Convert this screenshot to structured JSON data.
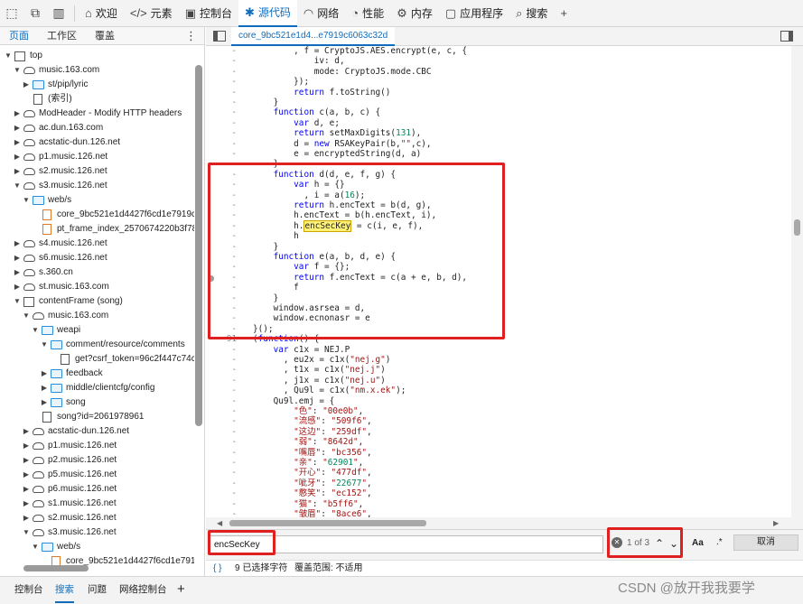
{
  "toolbar": {
    "tabs": [
      {
        "icon": "home-icon",
        "glyph": "⌂",
        "label": "欢迎"
      },
      {
        "icon": "elements-icon",
        "glyph": "</>",
        "label": "元素"
      },
      {
        "icon": "console-icon",
        "glyph": "▣",
        "label": "控制台"
      },
      {
        "icon": "sources-bug-icon",
        "glyph": "✱",
        "label": "源代码",
        "active": true
      },
      {
        "icon": "network-wifi-icon",
        "glyph": "◠",
        "label": "网络"
      },
      {
        "icon": "performance-icon",
        "glyph": "◔",
        "label": "性能"
      },
      {
        "icon": "memory-gear-icon",
        "glyph": "⚙",
        "label": "内存"
      },
      {
        "icon": "application-icon",
        "glyph": "▢",
        "label": "应用程序"
      },
      {
        "icon": "search-icon",
        "glyph": "⌕",
        "label": "搜索"
      }
    ],
    "add": "+"
  },
  "left": {
    "tabs": [
      "页面",
      "工作区",
      "覆盖"
    ],
    "more": "⋮",
    "tree": [
      {
        "indent": 0,
        "arrow": "▼",
        "icon": "frame",
        "label": "top"
      },
      {
        "indent": 1,
        "arrow": "▼",
        "icon": "cloud",
        "label": "music.163.com"
      },
      {
        "indent": 2,
        "arrow": "▶",
        "icon": "folder",
        "label": "st/pip/lyric"
      },
      {
        "indent": 2,
        "arrow": "",
        "icon": "file",
        "label": "(索引)"
      },
      {
        "indent": 1,
        "arrow": "▶",
        "icon": "cloud",
        "label": "ModHeader - Modify HTTP headers"
      },
      {
        "indent": 1,
        "arrow": "▶",
        "icon": "cloud",
        "label": "ac.dun.163.com"
      },
      {
        "indent": 1,
        "arrow": "▶",
        "icon": "cloud",
        "label": "acstatic-dun.126.net"
      },
      {
        "indent": 1,
        "arrow": "▶",
        "icon": "cloud",
        "label": "p1.music.126.net"
      },
      {
        "indent": 1,
        "arrow": "▶",
        "icon": "cloud",
        "label": "s2.music.126.net"
      },
      {
        "indent": 1,
        "arrow": "▼",
        "icon": "cloud",
        "label": "s3.music.126.net"
      },
      {
        "indent": 2,
        "arrow": "▼",
        "icon": "folder",
        "label": "web/s"
      },
      {
        "indent": 3,
        "arrow": "",
        "icon": "file-orange",
        "label": "core_9bc521e1d4427f6cd1e7919c"
      },
      {
        "indent": 3,
        "arrow": "",
        "icon": "file-orange",
        "label": "pt_frame_index_2570674220b3f78"
      },
      {
        "indent": 1,
        "arrow": "▶",
        "icon": "cloud",
        "label": "s4.music.126.net"
      },
      {
        "indent": 1,
        "arrow": "▶",
        "icon": "cloud",
        "label": "s6.music.126.net"
      },
      {
        "indent": 1,
        "arrow": "▶",
        "icon": "cloud",
        "label": "s.360.cn"
      },
      {
        "indent": 1,
        "arrow": "▶",
        "icon": "cloud",
        "label": "st.music.163.com"
      },
      {
        "indent": 1,
        "arrow": "▼",
        "icon": "frame",
        "label": "contentFrame (song)"
      },
      {
        "indent": 2,
        "arrow": "▼",
        "icon": "cloud",
        "label": "music.163.com"
      },
      {
        "indent": 3,
        "arrow": "▼",
        "icon": "folder",
        "label": "weapi"
      },
      {
        "indent": 4,
        "arrow": "▼",
        "icon": "folder",
        "label": "comment/resource/comments"
      },
      {
        "indent": 5,
        "arrow": "",
        "icon": "file",
        "label": "get?csrf_token=96c2f447c74c"
      },
      {
        "indent": 4,
        "arrow": "▶",
        "icon": "folder",
        "label": "feedback"
      },
      {
        "indent": 4,
        "arrow": "▶",
        "icon": "folder",
        "label": "middle/clientcfg/config"
      },
      {
        "indent": 4,
        "arrow": "▶",
        "icon": "folder",
        "label": "song"
      },
      {
        "indent": 3,
        "arrow": "",
        "icon": "file",
        "label": "song?id=2061978961"
      },
      {
        "indent": 2,
        "arrow": "▶",
        "icon": "cloud",
        "label": "acstatic-dun.126.net"
      },
      {
        "indent": 2,
        "arrow": "▶",
        "icon": "cloud",
        "label": "p1.music.126.net"
      },
      {
        "indent": 2,
        "arrow": "▶",
        "icon": "cloud",
        "label": "p2.music.126.net"
      },
      {
        "indent": 2,
        "arrow": "▶",
        "icon": "cloud",
        "label": "p5.music.126.net"
      },
      {
        "indent": 2,
        "arrow": "▶",
        "icon": "cloud",
        "label": "p6.music.126.net"
      },
      {
        "indent": 2,
        "arrow": "▶",
        "icon": "cloud",
        "label": "s1.music.126.net"
      },
      {
        "indent": 2,
        "arrow": "▶",
        "icon": "cloud",
        "label": "s2.music.126.net"
      },
      {
        "indent": 2,
        "arrow": "▼",
        "icon": "cloud",
        "label": "s3.music.126.net"
      },
      {
        "indent": 3,
        "arrow": "▼",
        "icon": "folder",
        "label": "web/s"
      },
      {
        "indent": 4,
        "arrow": "",
        "icon": "file-orange",
        "label": "core_9bc521e1d4427f6cd1e791"
      }
    ]
  },
  "editor": {
    "tab_label": "core_9bc521e1d4...e7919c6063c32d",
    "lines": [
      {
        "g": "-",
        "t": "        , f = CryptoJS.AES.encrypt(e, c, {"
      },
      {
        "g": "-",
        "t": "            iv: d,"
      },
      {
        "g": "-",
        "t": "            mode: CryptoJS.mode.CBC"
      },
      {
        "g": "-",
        "t": "        });"
      },
      {
        "g": "-",
        "t": "        return f.toString()"
      },
      {
        "g": "-",
        "t": "    }"
      },
      {
        "g": "-",
        "t": "    function c(a, b, c) {"
      },
      {
        "g": "-",
        "t": "        var d, e;"
      },
      {
        "g": "-",
        "t": "        return setMaxDigits(131),"
      },
      {
        "g": "-",
        "t": "        d = new RSAKeyPair(b,\"\",c),"
      },
      {
        "g": "-",
        "t": "        e = encryptedString(d, a)"
      },
      {
        "g": "-",
        "t": "    }"
      },
      {
        "g": "-",
        "t": "    function d(d, e, f, g) {"
      },
      {
        "g": "-",
        "t": "        var h = {}"
      },
      {
        "g": "-",
        "t": "          , i = a(16);"
      },
      {
        "g": "-",
        "t": "        return h.encText = b(d, g),"
      },
      {
        "g": "-",
        "t": "        h.encText = b(h.encText, i),"
      },
      {
        "g": "-",
        "t": "        h.encSecKey = c(i, e, f),",
        "hl": "encSecKey"
      },
      {
        "g": "-",
        "t": "        h"
      },
      {
        "g": "-",
        "t": "    }"
      },
      {
        "g": "-",
        "t": "    function e(a, b, d, e) {"
      },
      {
        "g": "-",
        "t": "        var f = {};"
      },
      {
        "g": "-",
        "t": "        return f.encText = c(a + e, b, d),"
      },
      {
        "g": "-",
        "t": "        f"
      },
      {
        "g": "-",
        "t": "    }"
      },
      {
        "g": "-",
        "t": "    window.asrsea = d,"
      },
      {
        "g": "-",
        "t": "    window.ecnonasr = e"
      },
      {
        "g": "-",
        "t": "}();"
      },
      {
        "g": "91",
        "t": "(function() {"
      },
      {
        "g": "-",
        "t": "    var c1x = NEJ.P"
      },
      {
        "g": "-",
        "t": "      , eu2x = c1x(\"nej.g\")"
      },
      {
        "g": "-",
        "t": "      , t1x = c1x(\"nej.j\")"
      },
      {
        "g": "-",
        "t": "      , j1x = c1x(\"nej.u\")"
      },
      {
        "g": "-",
        "t": "      , Qu9l = c1x(\"nm.x.ek\");"
      },
      {
        "g": "-",
        "t": "    Qu9l.emj = {"
      },
      {
        "g": "-",
        "t": "        \"色\": \"00e0b\","
      },
      {
        "g": "-",
        "t": "        \"流感\": \"509f6\","
      },
      {
        "g": "-",
        "t": "        \"这边\": \"259df\","
      },
      {
        "g": "-",
        "t": "        \"弱\": \"8642d\","
      },
      {
        "g": "-",
        "t": "        \"嘴唇\": \"bc356\","
      },
      {
        "g": "-",
        "t": "        \"亲\": \"62901\","
      },
      {
        "g": "-",
        "t": "        \"开心\": \"477df\","
      },
      {
        "g": "-",
        "t": "        \"呲牙\": \"22677\","
      },
      {
        "g": "-",
        "t": "        \"憨笑\": \"ec152\","
      },
      {
        "g": "-",
        "t": "        \"猫\": \"b5ff6\","
      },
      {
        "g": "-",
        "t": "        \"皱眉\": \"8ace6\","
      }
    ]
  },
  "search": {
    "query": "encSecKey",
    "match_count": "1 of 3",
    "prev": "⌃",
    "next": "⌄",
    "case_label": "Aa",
    "regex_label": ".*",
    "cancel_label": "取消"
  },
  "status": {
    "braces": "{ }",
    "selection": "9 已选择字符",
    "coverage": "覆盖范围: 不适用"
  },
  "drawer": {
    "tabs": [
      "控制台",
      "搜索",
      "问题",
      "网络控制台"
    ],
    "add": "+"
  },
  "watermark": "CSDN @放开我我要学",
  "colors": {
    "accent": "#0f6cbd",
    "annotation_red": "#e02020",
    "highlight": "#fff176"
  }
}
